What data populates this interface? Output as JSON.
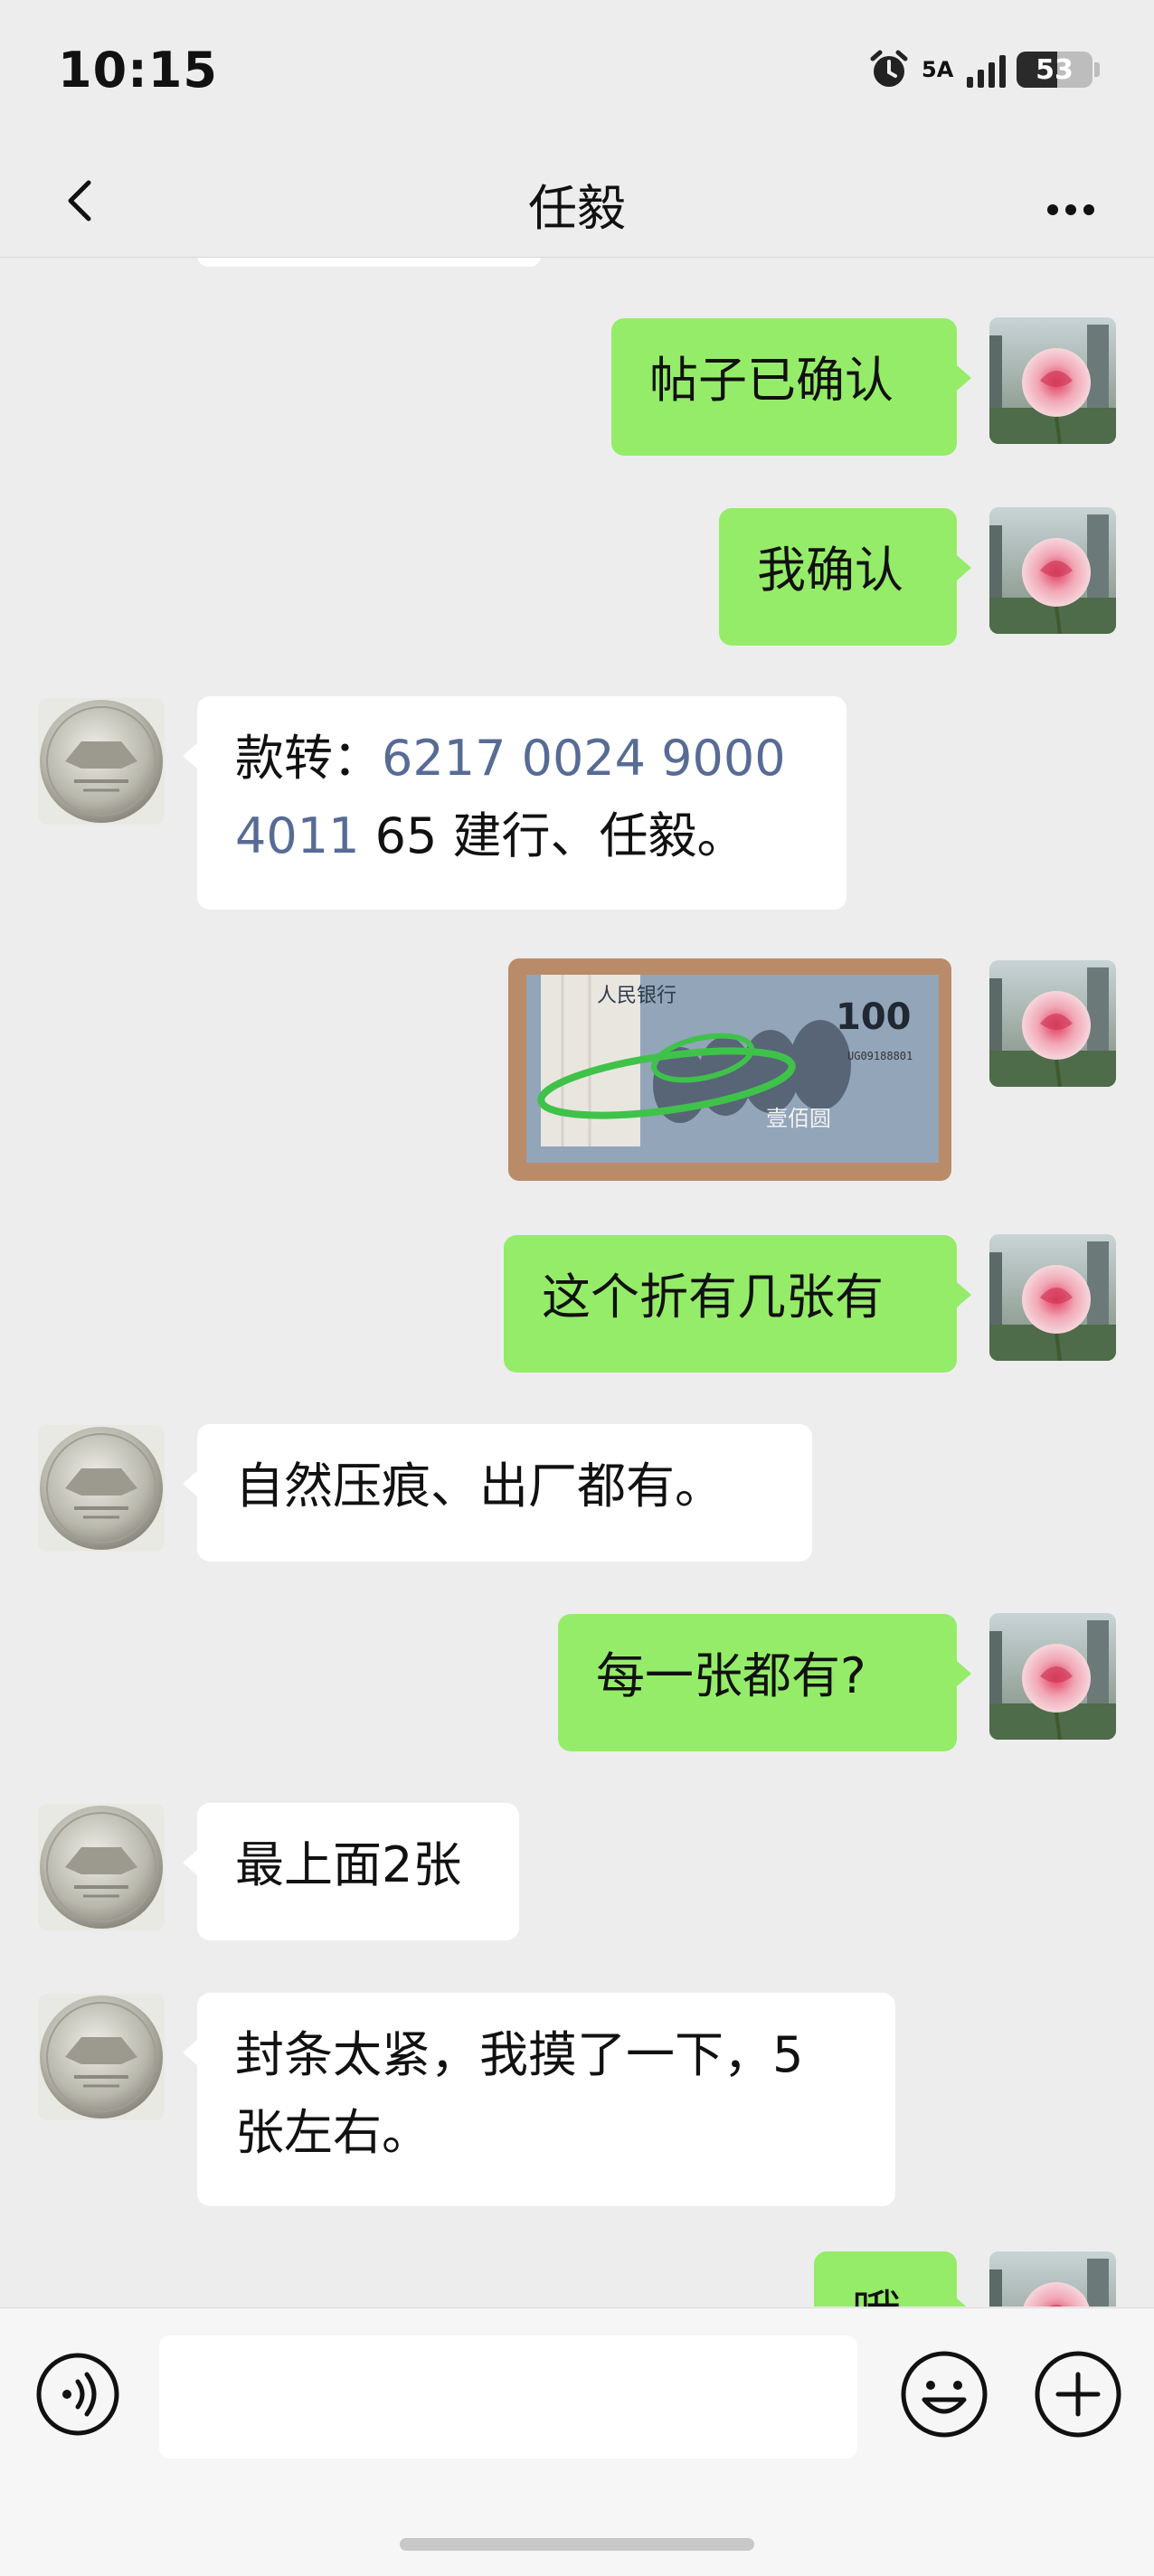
{
  "status_bar": {
    "time": "10:15",
    "network": "5A",
    "battery": "53",
    "battery_level_percent": 53
  },
  "nav": {
    "title": "任毅"
  },
  "messages": [
    {
      "side": "out",
      "text": "帖子已确认"
    },
    {
      "side": "out",
      "text": "我确认"
    },
    {
      "side": "in",
      "prefix": "款转：",
      "link_line1": "6217 0024 9000",
      "link_line2": "4011",
      "suffix": " 65 建行、任毅。"
    },
    {
      "side": "out",
      "type": "image",
      "alt": "100元人民币纸币照片"
    },
    {
      "side": "out",
      "text": "这个折有几张有"
    },
    {
      "side": "in",
      "text": "自然压痕、出厂都有。"
    },
    {
      "side": "out",
      "text": "每一张都有?"
    },
    {
      "side": "in",
      "text": "最上面2张"
    },
    {
      "side": "in",
      "line1": "封条太紧，我摸了一下，5",
      "line2": "张左右。"
    },
    {
      "side": "out",
      "text": "哦"
    }
  ],
  "photo": {
    "banknote_header": "人民银行",
    "denomination": "100",
    "denomination_text": "壹佰圆",
    "serial": "UG09188801"
  },
  "icons": {
    "back": "chevron-left-icon",
    "more": "more-dots-icon",
    "voice": "voice-icon",
    "emoji": "emoji-icon",
    "plus": "plus-icon"
  },
  "colors": {
    "outgoing_bubble": "#95ec69",
    "incoming_bubble": "#ffffff",
    "link": "#576b95",
    "background": "#ededed"
  }
}
